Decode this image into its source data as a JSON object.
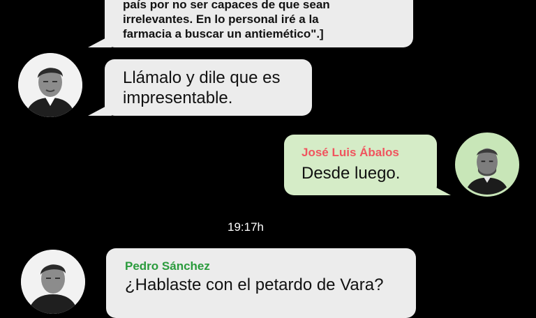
{
  "messages": [
    {
      "id": "m1",
      "direction": "incoming",
      "text_lines": [
        "país por no ser capaces de que sean",
        "irrelevantes. En lo personal iré a la",
        "farmacia a buscar un antiemético\".]"
      ]
    },
    {
      "id": "m2",
      "direction": "incoming",
      "avatar": "pedro-sanchez-avatar",
      "text_lines": [
        "Llámalo y dile que es",
        "impresentable."
      ]
    },
    {
      "id": "m3",
      "direction": "outgoing",
      "sender": "José Luis Ábalos",
      "sender_color": "#f0545e",
      "avatar": "jose-luis-abalos-avatar",
      "text": "Desde luego."
    },
    {
      "id": "m4",
      "direction": "incoming",
      "sender": "Pedro Sánchez",
      "sender_color": "#2a9b3c",
      "avatar": "pedro-sanchez-avatar",
      "text": "¿Hablaste con el petardo de Vara?"
    }
  ],
  "timestamp": "19:17h",
  "colors": {
    "background": "#000000",
    "incoming_bubble": "#ececec",
    "outgoing_bubble": "#d5ecc7",
    "outgoing_avatar_bg": "#c8e6b8"
  }
}
